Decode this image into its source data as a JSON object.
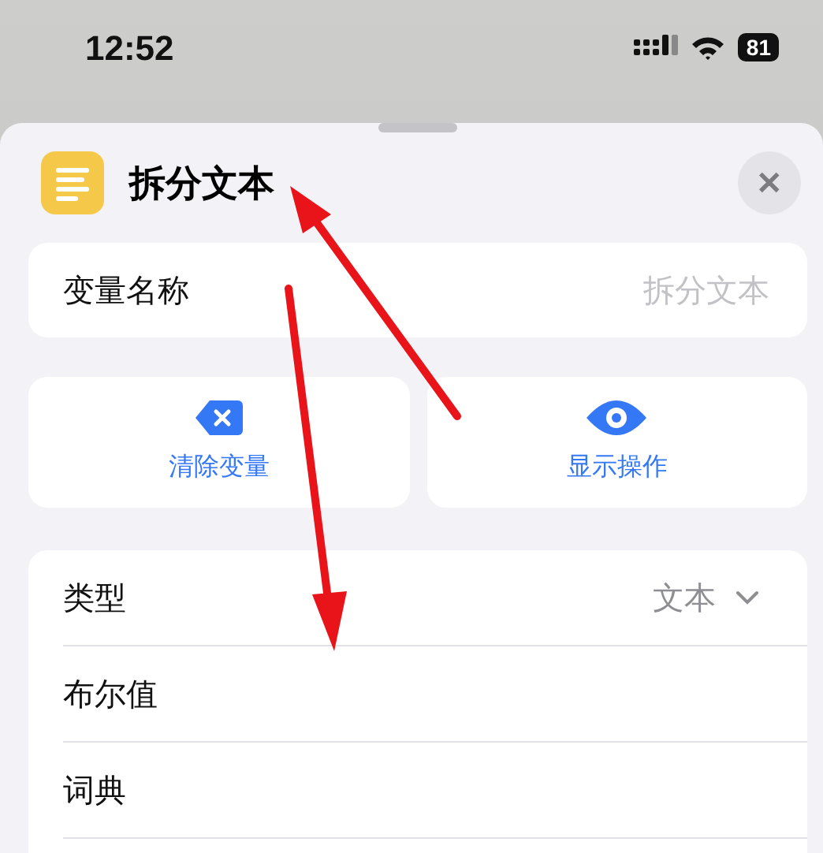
{
  "status_bar": {
    "time": "12:52",
    "battery": "81"
  },
  "sheet": {
    "title": "拆分文本",
    "close": "✕"
  },
  "variable": {
    "label": "变量名称",
    "placeholder": "拆分文本"
  },
  "actions": [
    {
      "kind": "clear",
      "label": "清除变量"
    },
    {
      "kind": "show",
      "label": "显示操作"
    }
  ],
  "type_list": [
    {
      "kind": "picker",
      "label": "类型",
      "value": "文本"
    },
    {
      "kind": "option",
      "label": "布尔值"
    },
    {
      "kind": "option",
      "label": "词典"
    }
  ]
}
